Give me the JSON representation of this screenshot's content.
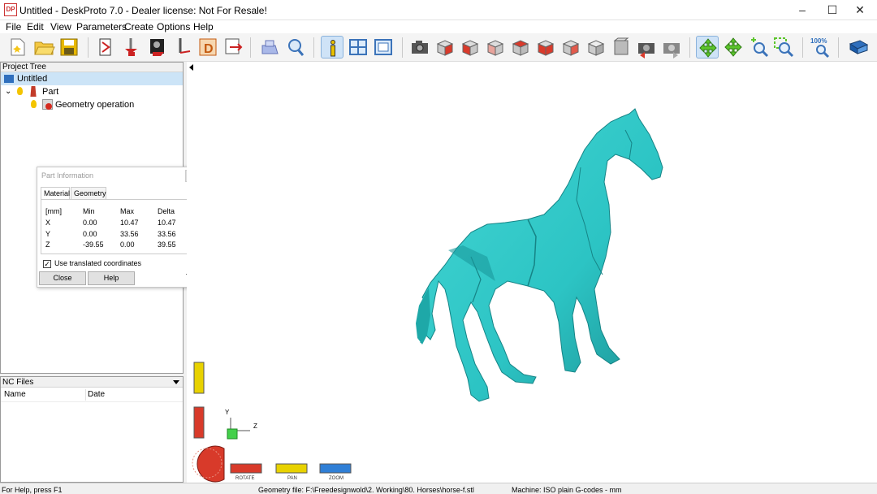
{
  "window": {
    "title": "Untitled - DeskProto 7.0 - Dealer license: Not For Resale!",
    "app_icon": "DP",
    "controls": [
      "minimize-icon",
      "maximize-icon",
      "close-icon"
    ]
  },
  "menu": [
    "File",
    "Edit",
    "View",
    "Parameters",
    "Create",
    "Options",
    "Help"
  ],
  "toolbar": {
    "icons": [
      "new-file-icon",
      "open-folder-icon",
      "save-icon",
      "part-wizard-icon",
      "vector-wizard-icon",
      "bitmap-wizard-icon",
      "drill-wizard-icon",
      "layer-icon",
      "export-icon",
      "paint-icon",
      "magnifier-icon",
      "info-icon",
      "layout-icon",
      "frame-icon",
      "camera-icon",
      "view-front-icon",
      "view-back-icon",
      "view-left-icon",
      "view-right-icon",
      "view-top-icon",
      "view-bottom-icon",
      "view-iso-icon",
      "view-iso2-icon",
      "undo-view-icon",
      "redo-view-icon",
      "rotate-icon",
      "move-icon",
      "zoom-in-icon",
      "zoom-window-icon",
      "zoom-100-icon",
      "book-icon"
    ],
    "zoom_label": "100%"
  },
  "project_tree": {
    "header": "Project Tree",
    "items": [
      {
        "label": "Untitled",
        "icon": "project-icon"
      },
      {
        "label": "Part",
        "icon": "part-icon"
      },
      {
        "label": "Geometry operation",
        "icon": "geometry-operation-icon"
      }
    ]
  },
  "part_info": {
    "title": "Part Information",
    "tabs": [
      "Material",
      "Geometry"
    ],
    "columns": [
      "[mm]",
      "Min",
      "Max",
      "Delta"
    ],
    "rows": [
      [
        "X",
        "0.00",
        "10.47",
        "10.47"
      ],
      [
        "Y",
        "0.00",
        "33.56",
        "33.56"
      ],
      [
        "Z",
        "-39.55",
        "0.00",
        "39.55"
      ]
    ],
    "checkbox_label": "Use translated coordinates",
    "checkbox_checked": true,
    "close_label": "Close",
    "help_label": "Help"
  },
  "nc_files": {
    "header": "NC Files",
    "columns": [
      "Name",
      "Date"
    ]
  },
  "axes": {
    "y": "Y",
    "z": "Z"
  },
  "view_controls": {
    "rotate": "ROTATE",
    "pan": "PAN",
    "zoom": "ZOOM"
  },
  "colors": {
    "model": "#2cc4c4",
    "model_shadow": "#1b8f91",
    "rotate": "#d83a2a",
    "pan": "#e8d200",
    "zoom": "#2f7fd6",
    "selection": "#cce4f7"
  },
  "status": {
    "help": "For Help, press F1",
    "geometry_file": "Geometry file: F:\\Freedesignwold\\2. Working\\80. Horses\\horse-f.stl",
    "machine": "Machine: ISO plain G-codes - mm"
  }
}
